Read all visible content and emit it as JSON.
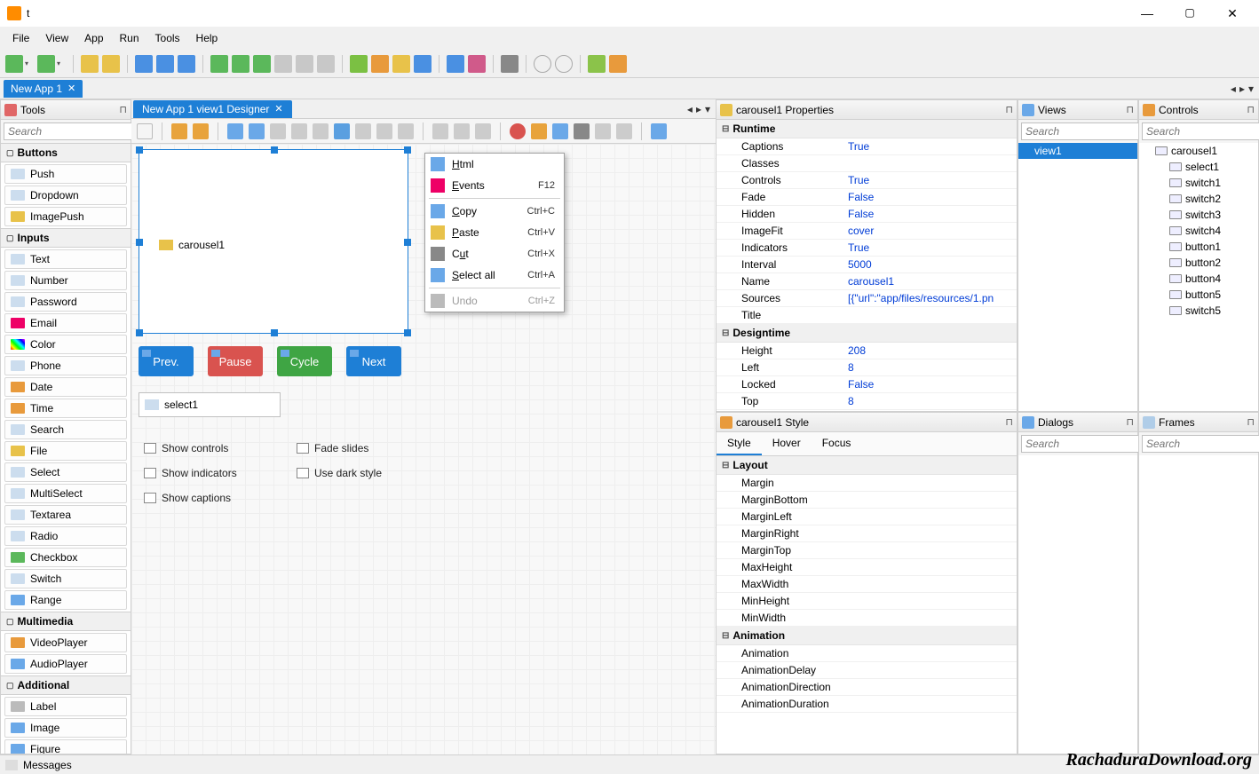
{
  "title_letter": "t",
  "menubar": [
    "File",
    "View",
    "App",
    "Run",
    "Tools",
    "Help"
  ],
  "app_tab": "New App 1",
  "tools_panel": {
    "title": "Tools",
    "search_placeholder": "Search",
    "categories": [
      {
        "name": "Buttons",
        "items": [
          "Push",
          "Dropdown",
          "ImagePush"
        ]
      },
      {
        "name": "Inputs",
        "items": [
          "Text",
          "Number",
          "Password",
          "Email",
          "Color",
          "Phone",
          "Date",
          "Time",
          "Search",
          "File",
          "Select",
          "MultiSelect",
          "Textarea",
          "Radio",
          "Checkbox",
          "Switch",
          "Range"
        ]
      },
      {
        "name": "Multimedia",
        "items": [
          "VideoPlayer",
          "AudioPlayer"
        ]
      },
      {
        "name": "Additional",
        "items": [
          "Label",
          "Image",
          "Figure"
        ]
      }
    ]
  },
  "designer_tab": "New App 1 view1 Designer",
  "canvas": {
    "carousel_label": "carousel1",
    "buttons": [
      {
        "label": "Prev.",
        "color": "#1e7fd6"
      },
      {
        "label": "Pause",
        "color": "#d9534f"
      },
      {
        "label": "Cycle",
        "color": "#3fa544"
      },
      {
        "label": "Next",
        "color": "#1e7fd6"
      }
    ],
    "select_label": "select1",
    "checks_left": [
      "Show controls",
      "Show indicators",
      "Show captions"
    ],
    "checks_right": [
      "Fade slides",
      "Use dark style"
    ]
  },
  "context_menu": [
    {
      "label": "Html",
      "shortcut": "",
      "u": "H"
    },
    {
      "label": "Events",
      "shortcut": "F12",
      "u": "E"
    },
    {
      "sep": true
    },
    {
      "label": "Copy",
      "shortcut": "Ctrl+C",
      "u": "C"
    },
    {
      "label": "Paste",
      "shortcut": "Ctrl+V",
      "u": "P"
    },
    {
      "label": "Cut",
      "shortcut": "Ctrl+X",
      "u": "u",
      "full": "Cut"
    },
    {
      "label": "Select all",
      "shortcut": "Ctrl+A",
      "u": "S"
    },
    {
      "sep": true
    },
    {
      "label": "Undo",
      "shortcut": "Ctrl+Z",
      "disabled": true
    }
  ],
  "properties": {
    "title": "carousel1 Properties",
    "groups": [
      {
        "name": "Runtime",
        "rows": [
          [
            "Captions",
            "True"
          ],
          [
            "Classes",
            ""
          ],
          [
            "Controls",
            "True"
          ],
          [
            "Fade",
            "False"
          ],
          [
            "Hidden",
            "False"
          ],
          [
            "ImageFit",
            "cover"
          ],
          [
            "Indicators",
            "True"
          ],
          [
            "Interval",
            "5000"
          ],
          [
            "Name",
            "carousel1"
          ],
          [
            "Sources",
            "[{\"url\":\"app/files/resources/1.pn"
          ],
          [
            "Title",
            ""
          ]
        ]
      },
      {
        "name": "Designtime",
        "rows": [
          [
            "Height",
            "208"
          ],
          [
            "Left",
            "8"
          ],
          [
            "Locked",
            "False"
          ],
          [
            "Top",
            "8"
          ]
        ]
      }
    ]
  },
  "style_panel": {
    "title": "carousel1 Style",
    "tabs": [
      "Style",
      "Hover",
      "Focus"
    ],
    "groups": [
      {
        "name": "Layout",
        "rows": [
          "Margin",
          "MarginBottom",
          "MarginLeft",
          "MarginRight",
          "MarginTop",
          "MaxHeight",
          "MaxWidth",
          "MinHeight",
          "MinWidth"
        ]
      },
      {
        "name": "Animation",
        "rows": [
          "Animation",
          "AnimationDelay",
          "AnimationDirection",
          "AnimationDuration"
        ]
      }
    ]
  },
  "views_panel": {
    "title": "Views",
    "search_placeholder": "Search",
    "items": [
      "view1"
    ]
  },
  "controls_panel": {
    "title": "Controls",
    "search_placeholder": "Search",
    "items": [
      "carousel1",
      "select1",
      "switch1",
      "switch2",
      "switch3",
      "switch4",
      "button1",
      "button2",
      "button4",
      "button5",
      "switch5"
    ]
  },
  "dialogs_panel": {
    "title": "Dialogs",
    "search_placeholder": "Search"
  },
  "frames_panel": {
    "title": "Frames",
    "search_placeholder": "Search"
  },
  "statusbar": "Messages",
  "watermark": "RachaduraDownload.org"
}
